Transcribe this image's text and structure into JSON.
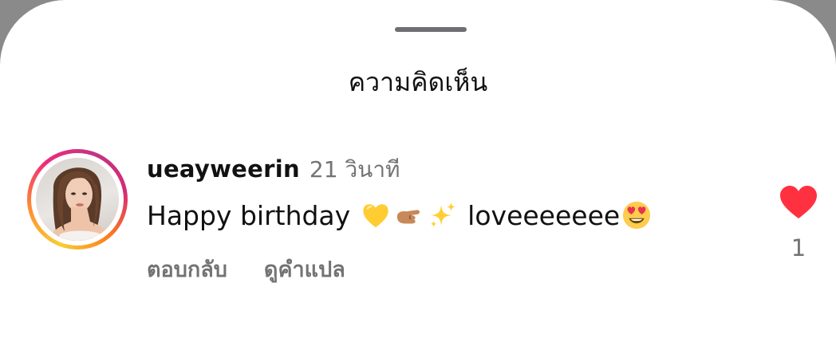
{
  "header": {
    "title": "ความคิดเห็น"
  },
  "comment": {
    "username": "ueayweerin",
    "time": "21 วินาที",
    "text_part1": "Happy birthday ",
    "text_part2": " loveeeeeee",
    "emojis": [
      "yellow-heart-emoji",
      "pinching-hand-emoji",
      "sparkles-emoji",
      "heart-eyes-emoji"
    ],
    "reply_label": "ตอบกลับ",
    "translate_label": "ดูคำแปล",
    "like_count": "1"
  },
  "colors": {
    "like_red": "#ff3040",
    "secondary_text": "#737373",
    "primary_text": "#111111"
  }
}
